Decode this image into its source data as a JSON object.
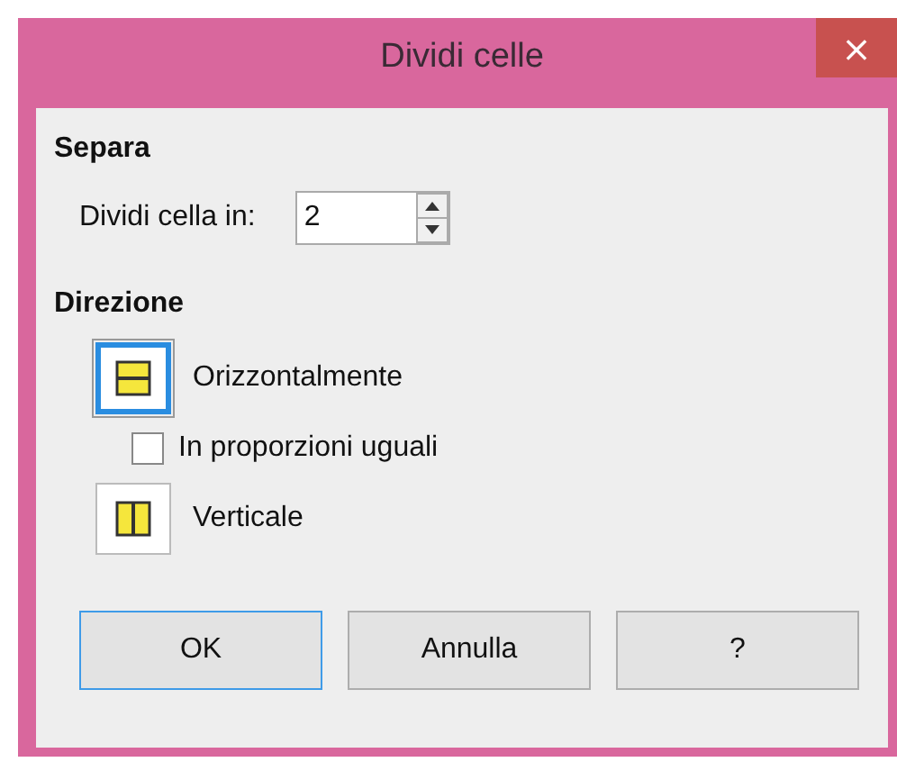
{
  "window": {
    "title": "Dividi celle",
    "close": "×"
  },
  "split": {
    "heading": "Separa",
    "label": "Dividi cella in:",
    "value": "2"
  },
  "direction": {
    "heading": "Direzione",
    "options": [
      {
        "kind": "horizontal",
        "label": "Orizzontalmente",
        "selected": true
      },
      {
        "kind": "checkbox",
        "label": "In proporzioni uguali",
        "checked": false
      },
      {
        "kind": "vertical",
        "label": "Verticale",
        "selected": false
      }
    ]
  },
  "buttons": [
    {
      "label": "OK",
      "focused": true
    },
    {
      "label": "Annulla",
      "focused": false
    },
    {
      "label": "?",
      "focused": false
    }
  ]
}
